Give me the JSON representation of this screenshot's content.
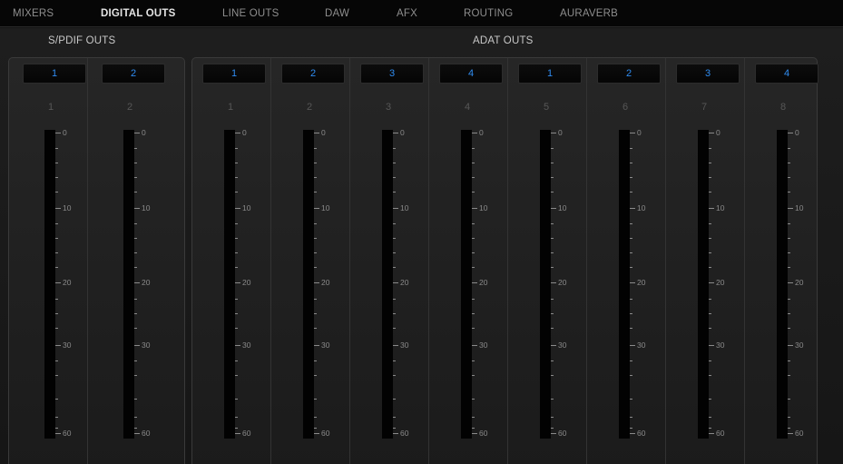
{
  "tabs": [
    {
      "label": "MIXERS",
      "active": false
    },
    {
      "label": "DIGITAL OUTS",
      "active": true
    },
    {
      "label": "LINE OUTS",
      "active": false
    },
    {
      "label": "DAW",
      "active": false
    },
    {
      "label": "AFX",
      "active": false
    },
    {
      "label": "ROUTING",
      "active": false
    },
    {
      "label": "AURAVERB",
      "active": false
    }
  ],
  "sections": {
    "spdif": {
      "title": "S/PDIF OUTS",
      "channels": [
        {
          "button": "1",
          "label": "1"
        },
        {
          "button": "2",
          "label": "2"
        }
      ]
    },
    "adat": {
      "title": "ADAT OUTS",
      "channels": [
        {
          "button": "1",
          "label": "1"
        },
        {
          "button": "2",
          "label": "2"
        },
        {
          "button": "3",
          "label": "3"
        },
        {
          "button": "4",
          "label": "4"
        },
        {
          "button": "1",
          "label": "5"
        },
        {
          "button": "2",
          "label": "6"
        },
        {
          "button": "3",
          "label": "7"
        },
        {
          "button": "4",
          "label": "8"
        }
      ]
    }
  },
  "meter_scale": [
    "0",
    "10",
    "20",
    "30",
    "60"
  ],
  "colors": {
    "accent": "#2f8cf0",
    "background": "#141414",
    "meter": "#020202"
  }
}
